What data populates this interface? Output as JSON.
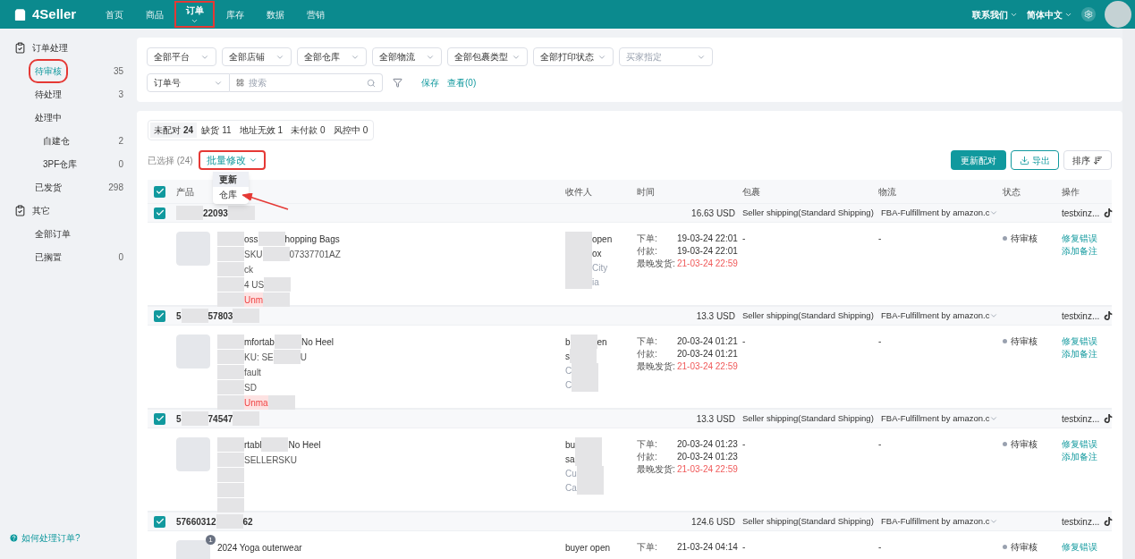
{
  "topbar": {
    "brand": "4Seller",
    "nav": [
      {
        "label": "首页",
        "selected": false,
        "highlighted": false
      },
      {
        "label": "商品",
        "selected": false,
        "highlighted": false
      },
      {
        "label": "订单",
        "selected": true,
        "highlighted": true
      },
      {
        "label": "库存",
        "selected": false,
        "highlighted": false
      },
      {
        "label": "数据",
        "selected": false,
        "highlighted": false
      },
      {
        "label": "营销",
        "selected": false,
        "highlighted": false
      }
    ],
    "right": [
      {
        "label": "联系我们"
      },
      {
        "label": "简体中文"
      }
    ]
  },
  "sidebar": {
    "groups": [
      {
        "title": "订单处理",
        "items": [
          {
            "label": "待审核",
            "count": "35",
            "selected": true,
            "highlighted": true
          },
          {
            "label": "待处理",
            "count": "3",
            "selected": false,
            "highlighted": false
          },
          {
            "label": "处理中",
            "selected": false,
            "highlighted": false,
            "children": [
              {
                "label": "自建仓",
                "count": "2",
                "selected": false,
                "highlighted": false
              },
              {
                "label": "3PF仓库",
                "count": "0",
                "selected": false,
                "highlighted": false
              }
            ]
          },
          {
            "label": "已发货",
            "count": "298",
            "selected": false,
            "highlighted": false
          }
        ]
      },
      {
        "title": "其它",
        "items": [
          {
            "label": "全部订单",
            "selected": false,
            "highlighted": false
          },
          {
            "label": "已搁置",
            "count": "0",
            "selected": false,
            "highlighted": false
          }
        ]
      }
    ],
    "help": "如何处理订单?"
  },
  "filters": {
    "dropdowns": [
      {
        "value": "全部平台"
      },
      {
        "value": "全部店铺"
      },
      {
        "value": "全部仓库"
      },
      {
        "value": "全部物流"
      },
      {
        "value": "全部包裹类型"
      },
      {
        "value": "全部打印状态"
      },
      {
        "placeholder": "买家指定"
      }
    ],
    "search_type": "订单号",
    "search": {
      "placeholder": "搜索"
    },
    "save": "保存",
    "view": "查看(0)"
  },
  "status_tabs": [
    {
      "label": "未配对",
      "count": "24",
      "selected": true
    },
    {
      "label": "缺货",
      "count": "11",
      "selected": false
    },
    {
      "label": "地址无效",
      "count": "1",
      "selected": false
    },
    {
      "label": "未付款",
      "count": "0",
      "selected": false
    },
    {
      "label": "风控中",
      "count": "0",
      "selected": false
    }
  ],
  "toolbar": {
    "selected_label": "已选择 (24)",
    "bulk_edit": {
      "label": "批量修改",
      "highlighted": true,
      "menu": [
        {
          "label": "更新",
          "hovered": true
        },
        {
          "label": "仓库",
          "hovered": false
        }
      ]
    },
    "buttons": [
      {
        "kind": "primary",
        "label": "更新配对"
      },
      {
        "kind": "export",
        "label": "导出"
      },
      {
        "kind": "sort",
        "label": "排序"
      }
    ]
  },
  "table": {
    "all_checked": true,
    "columns": [
      "产品",
      "收件人",
      "时间",
      "包裹",
      "物流",
      "状态",
      "操作"
    ],
    "orders": [
      {
        "checked": true,
        "id": [
          {
            "kind": "redacted"
          },
          {
            "kind": "text",
            "text": "22093"
          },
          {
            "kind": "redacted"
          }
        ],
        "amount": "16.63 USD",
        "shipping": "Seller shipping(Standard Shipping)",
        "logistics": "FBA-Fulfillment by amazon.c",
        "store": "testxinz...",
        "product": [
          [
            {
              "kind": "redacted"
            },
            {
              "kind": "text",
              "text": "oss"
            },
            {
              "kind": "redacted"
            },
            {
              "kind": "text",
              "text": "hopping Bags"
            }
          ],
          [
            {
              "kind": "redacted"
            },
            {
              "kind": "text",
              "text": "SKU"
            },
            {
              "kind": "redacted"
            },
            {
              "kind": "text",
              "text": "07337701AZ"
            }
          ],
          [
            {
              "kind": "redacted"
            },
            {
              "kind": "text",
              "text": "ck"
            }
          ],
          [
            {
              "kind": "redacted"
            },
            {
              "kind": "text",
              "text": "4 US"
            },
            {
              "kind": "redacted"
            }
          ]
        ],
        "tag": [
          {
            "kind": "redacted"
          },
          {
            "kind": "text",
            "text": "Unm"
          },
          {
            "kind": "redacted"
          }
        ],
        "receiver": [
          [
            {
              "kind": "redacted"
            },
            {
              "kind": "text",
              "text": "open"
            }
          ],
          [
            {
              "kind": "redacted"
            },
            {
              "kind": "text",
              "text": "ox"
            }
          ],
          [
            {
              "kind": "redacted"
            },
            {
              "kind": "text",
              "text": "City"
            }
          ],
          [
            {
              "kind": "redacted"
            },
            {
              "kind": "text",
              "text": "ia"
            }
          ]
        ],
        "times": [
          {
            "label": "下单:",
            "value": "19-03-24 22:01",
            "overdue": false
          },
          {
            "label": "付款:",
            "value": "19-03-24 22:01",
            "overdue": false
          },
          {
            "label": "最晚发货:",
            "value": "21-03-24 22:59",
            "overdue": true
          }
        ],
        "package": "-",
        "logistics_detail": "-",
        "status": "待审核",
        "actions": [
          "修复错误",
          "添加备注"
        ]
      },
      {
        "checked": true,
        "id": [
          {
            "kind": "text",
            "text": "5"
          },
          {
            "kind": "redacted"
          },
          {
            "kind": "text",
            "text": "57803"
          },
          {
            "kind": "redacted"
          }
        ],
        "amount": "13.3 USD",
        "shipping": "Seller shipping(Standard Shipping)",
        "logistics": "FBA-Fulfillment by amazon.c",
        "store": "testxinz...",
        "product": [
          [
            {
              "kind": "redacted"
            },
            {
              "kind": "text",
              "text": "mfortab"
            },
            {
              "kind": "redacted"
            },
            {
              "kind": "text",
              "text": "No Heel"
            }
          ],
          [
            {
              "kind": "redacted"
            },
            {
              "kind": "text",
              "text": "KU: SE"
            },
            {
              "kind": "redacted"
            },
            {
              "kind": "text",
              "text": "U"
            }
          ],
          [
            {
              "kind": "redacted"
            },
            {
              "kind": "text",
              "text": "fault"
            }
          ],
          [
            {
              "kind": "redacted"
            },
            {
              "kind": "text",
              "text": "SD"
            }
          ]
        ],
        "tag": [
          {
            "kind": "redacted"
          },
          {
            "kind": "text",
            "text": "Unma"
          },
          {
            "kind": "redacted"
          }
        ],
        "receiver": [
          [
            {
              "kind": "text",
              "text": "b"
            },
            {
              "kind": "redacted"
            },
            {
              "kind": "text",
              "text": "en"
            }
          ],
          [
            {
              "kind": "text",
              "text": "s"
            },
            {
              "kind": "redacted"
            }
          ],
          [
            {
              "kind": "text",
              "text": "C"
            },
            {
              "kind": "redacted"
            }
          ],
          [
            {
              "kind": "text",
              "text": "C"
            },
            {
              "kind": "redacted"
            }
          ]
        ],
        "times": [
          {
            "label": "下单:",
            "value": "20-03-24 01:21",
            "overdue": false
          },
          {
            "label": "付款:",
            "value": "20-03-24 01:21",
            "overdue": false
          },
          {
            "label": "最晚发货:",
            "value": "21-03-24 22:59",
            "overdue": true
          }
        ],
        "package": "-",
        "logistics_detail": "-",
        "status": "待审核",
        "actions": [
          "修复错误",
          "添加备注"
        ]
      },
      {
        "checked": true,
        "id": [
          {
            "kind": "text",
            "text": "5"
          },
          {
            "kind": "redacted"
          },
          {
            "kind": "text",
            "text": "74547"
          },
          {
            "kind": "redacted"
          }
        ],
        "amount": "13.3 USD",
        "shipping": "Seller shipping(Standard Shipping)",
        "logistics": "FBA-Fulfillment by amazon.c",
        "store": "testxinz...",
        "product": [
          [
            {
              "kind": "redacted"
            },
            {
              "kind": "text",
              "text": "rtabl"
            },
            {
              "kind": "redacted"
            },
            {
              "kind": "text",
              "text": "No Heel"
            }
          ],
          [
            {
              "kind": "redacted"
            },
            {
              "kind": "text",
              "text": "SELLERSKU"
            }
          ],
          [
            {
              "kind": "redacted"
            }
          ],
          [
            {
              "kind": "redacted"
            }
          ]
        ],
        "tag": [
          {
            "kind": "redacted"
          }
        ],
        "receiver": [
          [
            {
              "kind": "text",
              "text": "bu"
            },
            {
              "kind": "redacted"
            }
          ],
          [
            {
              "kind": "text",
              "text": "sa"
            },
            {
              "kind": "redacted"
            }
          ],
          [
            {
              "kind": "text",
              "text": "Cu"
            },
            {
              "kind": "redacted"
            }
          ],
          [
            {
              "kind": "text",
              "text": "Ca"
            },
            {
              "kind": "redacted"
            }
          ]
        ],
        "times": [
          {
            "label": "下单:",
            "value": "20-03-24 01:23",
            "overdue": false
          },
          {
            "label": "付款:",
            "value": "20-03-24 01:23",
            "overdue": false
          },
          {
            "label": "最晚发货:",
            "value": "21-03-24 22:59",
            "overdue": true
          }
        ],
        "package": "-",
        "logistics_detail": "-",
        "status": "待审核",
        "actions": [
          "修复错误",
          "添加备注"
        ]
      },
      {
        "checked": true,
        "id": [
          {
            "kind": "text",
            "text": "57660312"
          },
          {
            "kind": "redacted"
          },
          {
            "kind": "text",
            "text": "62"
          }
        ],
        "amount": "124.6 USD",
        "shipping": "Seller shipping(Standard Shipping)",
        "logistics": "FBA-Fulfillment by amazon.c",
        "store": "testxinz...",
        "badge": "1",
        "product": [
          [
            {
              "kind": "text",
              "text": "2024 Yoga outerwear"
            }
          ]
        ],
        "receiver": [
          [
            {
              "kind": "text",
              "text": "buyer open"
            }
          ]
        ],
        "times": [
          {
            "label": "下单:",
            "value": "21-03-24 04:14",
            "overdue": false
          }
        ],
        "package": "-",
        "logistics_detail": "-",
        "status": "待审核",
        "actions": [
          "修复错误"
        ]
      }
    ]
  }
}
